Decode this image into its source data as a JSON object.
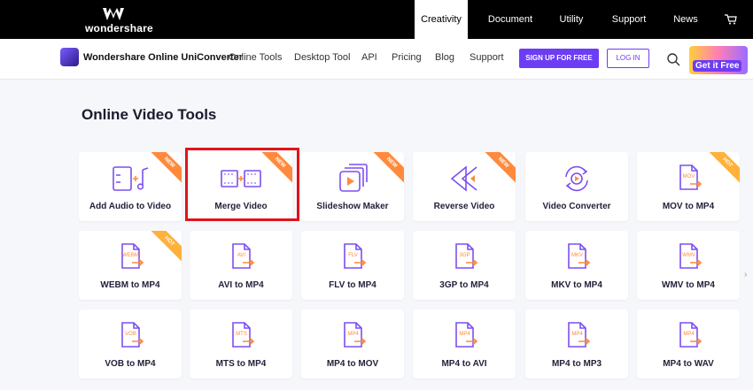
{
  "header": {
    "brand": "wondershare",
    "nav": [
      {
        "label": "Creativity",
        "active": true
      },
      {
        "label": "Document",
        "active": false
      },
      {
        "label": "Utility",
        "active": false
      },
      {
        "label": "Support",
        "active": false
      },
      {
        "label": "News",
        "active": false
      }
    ]
  },
  "product_nav": {
    "product_name": "Wondershare Online UniConverter",
    "links": [
      "Online Tools",
      "Desktop Tool",
      "API",
      "Pricing",
      "Blog",
      "Support"
    ],
    "signup_label": "SIGN UP FOR FREE",
    "login_label": "LOG IN",
    "promo_label": "Get it Free"
  },
  "page": {
    "title": "Online Video Tools",
    "tools": [
      {
        "label": "Add Audio to Video",
        "badge": "NEW",
        "icon": "audio-video-icon"
      },
      {
        "label": "Merge Video",
        "badge": "NEW",
        "icon": "merge-icon"
      },
      {
        "label": "Slideshow Maker",
        "badge": "NEW",
        "icon": "slideshow-icon"
      },
      {
        "label": "Reverse Video",
        "badge": "NEW",
        "icon": "reverse-icon"
      },
      {
        "label": "Video Converter",
        "badge": "",
        "icon": "converter-icon"
      },
      {
        "label": "MOV to MP4",
        "badge": "HOT",
        "icon": "file-icon",
        "file": "MOV"
      },
      {
        "label": "WEBM to MP4",
        "badge": "HOT",
        "icon": "file-icon",
        "file": "WEBM"
      },
      {
        "label": "AVI to MP4",
        "badge": "",
        "icon": "file-icon",
        "file": "AVI"
      },
      {
        "label": "FLV to MP4",
        "badge": "",
        "icon": "file-icon",
        "file": "FLV"
      },
      {
        "label": "3GP to MP4",
        "badge": "",
        "icon": "file-icon",
        "file": "3GP"
      },
      {
        "label": "MKV to MP4",
        "badge": "",
        "icon": "file-icon",
        "file": "MKV"
      },
      {
        "label": "WMV to MP4",
        "badge": "",
        "icon": "file-icon",
        "file": "WMV"
      },
      {
        "label": "VOB to MP4",
        "badge": "",
        "icon": "file-icon",
        "file": "VOB"
      },
      {
        "label": "MTS to MP4",
        "badge": "",
        "icon": "file-icon",
        "file": "MTS"
      },
      {
        "label": "MP4 to MOV",
        "badge": "",
        "icon": "file-icon",
        "file": "MP4"
      },
      {
        "label": "MP4 to AVI",
        "badge": "",
        "icon": "file-icon",
        "file": "MP4"
      },
      {
        "label": "MP4 to MP3",
        "badge": "",
        "icon": "file-icon",
        "file": "MP4"
      },
      {
        "label": "MP4 to WAV",
        "badge": "",
        "icon": "file-icon",
        "file": "MP4"
      }
    ]
  },
  "colors": {
    "accent": "#6d3cf5",
    "ribbon_new": "#ff8a3d",
    "ribbon_hot": "#ffb13b",
    "highlight": "#e0141b",
    "icon_purple": "#7b4ff0",
    "icon_orange": "#ff8a3d"
  }
}
